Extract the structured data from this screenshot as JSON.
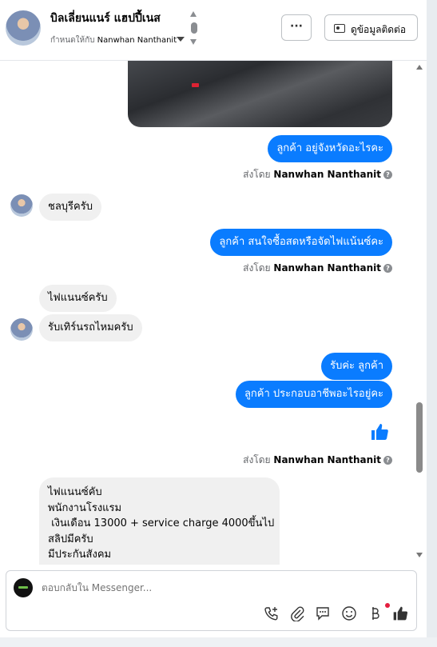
{
  "header": {
    "title": "บิลเลี่ยนแนร์ แฮปปี้เนส",
    "assigned_prefix": "กำหนดให้กับ",
    "assigned_name": "Nanwhan Nanthanit",
    "more_label": "···",
    "contact_label": "ดูข้อมูลติดต่อ"
  },
  "messages": [
    {
      "dir": "out",
      "text": "ลูกค้า อยู่จังหวัดอะไรคะ"
    },
    {
      "type": "sentby",
      "prefix": "ส่งโดย",
      "name": "Nanwhan Nanthanit"
    },
    {
      "dir": "in",
      "text": "ชลบุรีครับ"
    },
    {
      "dir": "out",
      "text": "ลูกค้า สนใจซื้อสดหรือจัดไฟแน้นซ์คะ"
    },
    {
      "type": "sentby",
      "prefix": "ส่งโดย",
      "name": "Nanwhan Nanthanit"
    },
    {
      "dir": "in",
      "text": "ไฟแนนซ์ครับ"
    },
    {
      "dir": "in",
      "text": "รับเทิร์นรถไหมครับ"
    },
    {
      "dir": "out",
      "text": "รับค่ะ  ลูกค้า"
    },
    {
      "dir": "out",
      "text": "ลูกค้า ประกอบอาชีพอะไรอยู่คะ"
    },
    {
      "type": "sentby",
      "prefix": "ส่งโดย",
      "name": "Nanwhan Nanthanit"
    }
  ],
  "long_message": [
    "ไฟแนนซ์คับ",
    "พนักงานโรงแรม",
    " เงินเดือน 13000 + service charge 4000ขึ้นไป",
    "สลิปมีครับ",
    "มีประกันสังคม"
  ],
  "composer": {
    "placeholder": "ตอบกลับใน Messenger..."
  },
  "icons": [
    "call-add-icon",
    "attachment-icon",
    "saved-replies-icon",
    "emoji-icon",
    "currency-icon",
    "like-icon"
  ],
  "colors": {
    "outgoing": "#0a7cff",
    "incoming": "#f0f0f0",
    "notification": "#e41e3f"
  }
}
